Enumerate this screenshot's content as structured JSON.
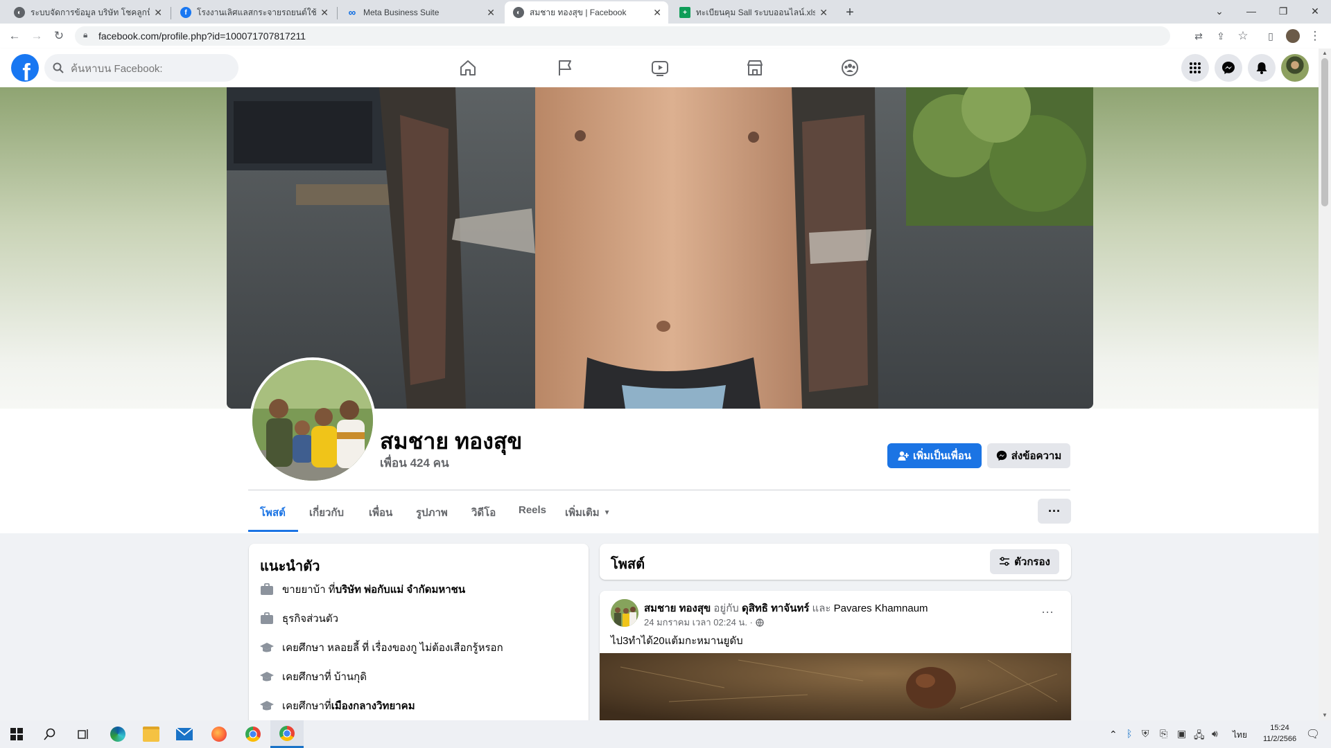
{
  "browser": {
    "tabs": [
      {
        "title": "ระบบจัดการข้อมูล บริษัท โชคลูกน็อต",
        "favicon": "chrome-globe-icon",
        "active": false
      },
      {
        "title": "โรงงานเลิศแลสกระจายรถยนต์ใช้แล้ว",
        "favicon": "facebook-icon",
        "active": false
      },
      {
        "title": "Meta Business Suite",
        "favicon": "meta-icon",
        "active": false
      },
      {
        "title": "สมชาย ทองสุข | Facebook",
        "favicon": "chrome-globe-icon",
        "active": true
      },
      {
        "title": "ทะเบียนคุม Sall ระบบออนไลน์.xlsx - G",
        "favicon": "sheets-icon",
        "active": false
      }
    ],
    "url": "facebook.com/profile.php?id=100071707817211"
  },
  "fb_nav": {
    "search_placeholder": "ค้นหาบน Facebook:",
    "tabs": [
      "home-icon",
      "pages-flag-icon",
      "watch-video-icon",
      "marketplace-icon",
      "groups-icon"
    ]
  },
  "profile": {
    "name": "สมชาย ทองสุข",
    "friends": "เพื่อน 424 คน",
    "add_friend": "เพิ่มเป็นเพื่อน",
    "message": "ส่งข้อความ",
    "tabs": [
      "โพสต์",
      "เกี่ยวกับ",
      "เพื่อน",
      "รูปภาพ",
      "วิดีโอ",
      "Reels",
      "เพิ่มเติม"
    ]
  },
  "intro": {
    "title": "แนะนำตัว",
    "items": [
      {
        "prefix": "ขายยาบ้า ที่ ",
        "bold": "บริษัท พ่อกับแม่ จำกัดมหาชน",
        "icon": "briefcase-icon"
      },
      {
        "prefix": "ธุรกิจส่วนตัว",
        "bold": "",
        "icon": "briefcase-icon"
      },
      {
        "prefix": "เคยศึกษา หลอยลี้ ที่ เรื่องของกู ไม่ต้องเสือกรู้หรอก",
        "bold": "",
        "icon": "graduation-cap-icon"
      },
      {
        "prefix": "เคยศึกษาที่ บ้านกุดิ",
        "bold": "",
        "icon": "graduation-cap-icon"
      },
      {
        "prefix": "เคยศึกษาที่ ",
        "bold": "เมืองกลางวิทยาคม",
        "icon": "graduation-cap-icon"
      }
    ]
  },
  "posts_header": {
    "title": "โพสต์",
    "filter": "ตัวกรอง"
  },
  "post": {
    "author": "สมชาย ทองสุข",
    "with_text": " อยู่กับ ",
    "tagged1": "ดุสิทธิ ทาจันทร์",
    "and_text": " และ ",
    "tagged2": "Pavares Khamnaum",
    "time": "24 มกราคม เวลา 02:24 น. ·",
    "body": "ไป3ทำได้20แต้มกะหมานยูดับ"
  },
  "taskbar": {
    "time": "15:24",
    "date": "11/2/2566",
    "lang": "ไทย"
  }
}
